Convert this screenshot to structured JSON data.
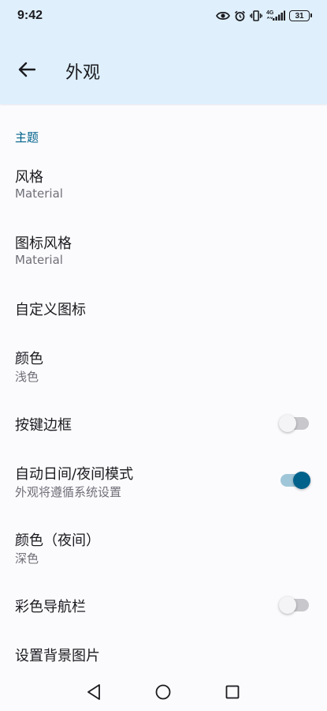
{
  "status_bar": {
    "time": "9:42",
    "network": "4G",
    "battery": "31"
  },
  "app_bar": {
    "title": "外观"
  },
  "sections": {
    "theme": {
      "header": "主题",
      "style": {
        "title": "风格",
        "value": "Material"
      },
      "icon_style": {
        "title": "图标风格",
        "value": "Material"
      },
      "custom_icon": {
        "title": "自定义图标"
      },
      "color": {
        "title": "颜色",
        "value": "浅色"
      },
      "key_border": {
        "title": "按键边框",
        "enabled": false
      },
      "auto_day_night": {
        "title": "自动日间/夜间模式",
        "summary": "外观将遵循系统设置",
        "enabled": true
      },
      "color_night": {
        "title": "颜色（夜间）",
        "value": "深色"
      },
      "colored_navbar": {
        "title": "彩色导航栏",
        "enabled": false
      },
      "background_image": {
        "title": "设置背景图片"
      }
    }
  },
  "colors": {
    "accent": "#00628b",
    "header_bg": "#dff0fc",
    "page_bg": "#fbfbfe"
  }
}
